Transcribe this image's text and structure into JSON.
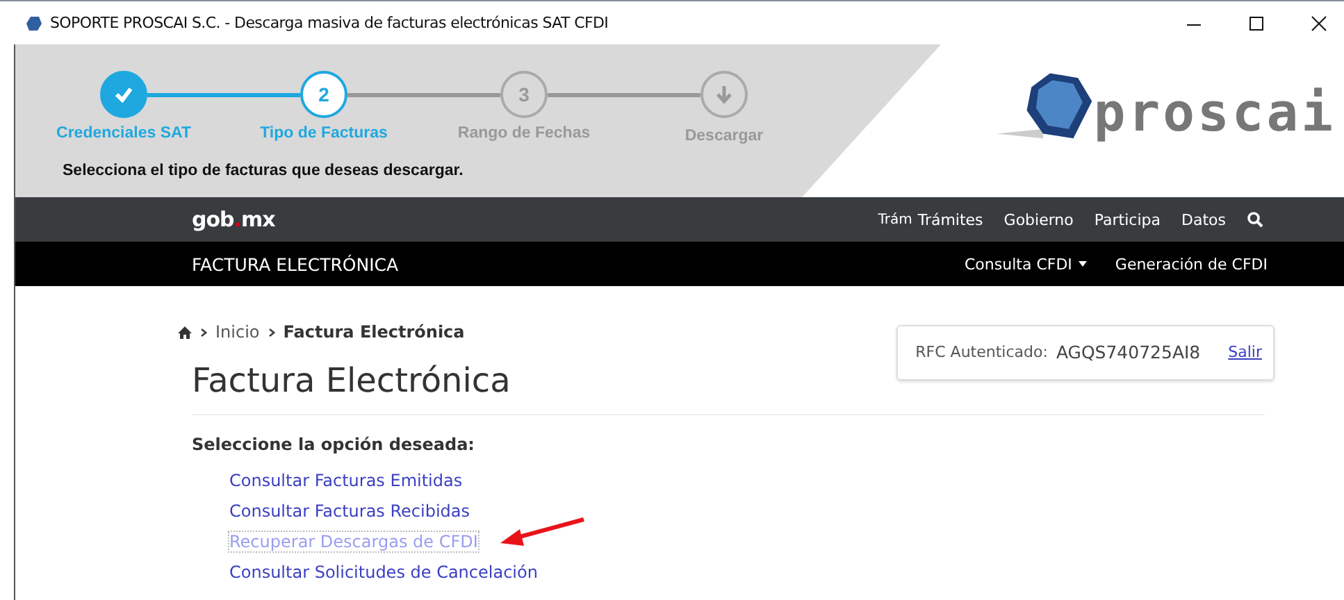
{
  "window": {
    "title": "SOPORTE PROSCAI S.C. - Descarga masiva de facturas electrónicas SAT CFDI"
  },
  "wizard": {
    "steps": [
      {
        "label": "Credenciales SAT",
        "kind": "done"
      },
      {
        "label": "Tipo de Facturas",
        "kind": "current",
        "number": "2"
      },
      {
        "label": "Rango de Fechas",
        "kind": "pending",
        "number": "3"
      },
      {
        "label": "Descargar",
        "kind": "download"
      }
    ],
    "instruction": "Selecciona el tipo de facturas que deseas descargar."
  },
  "logo": {
    "text": "proscai"
  },
  "top_nav": {
    "brand": "gob",
    "brand_dot": ".",
    "brand_tail": "mx",
    "items": [
      "Trám",
      "Trámites",
      "Gobierno",
      "Participa",
      "Datos"
    ]
  },
  "sub_nav": {
    "title": "FACTURA ELECTRÓNICA",
    "items": [
      {
        "label": "Consulta CFDI",
        "dropdown": true
      },
      {
        "label": "Generación de CFDI",
        "dropdown": false
      }
    ]
  },
  "breadcrumb": [
    "Inicio",
    "Factura Electrónica"
  ],
  "page": {
    "title": "Factura Electrónica",
    "prompt": "Seleccione la opción deseada:"
  },
  "options": [
    {
      "label": "Consultar Facturas Emitidas",
      "visited": false
    },
    {
      "label": "Consultar Facturas Recibidas",
      "visited": false
    },
    {
      "label": "Recuperar Descargas de CFDI",
      "visited": true
    },
    {
      "label": "Consultar Solicitudes de Cancelación",
      "visited": false
    }
  ],
  "session": {
    "label": "RFC Autenticado:",
    "rfc": "AGQS740725AI8",
    "logout": "Salir"
  }
}
